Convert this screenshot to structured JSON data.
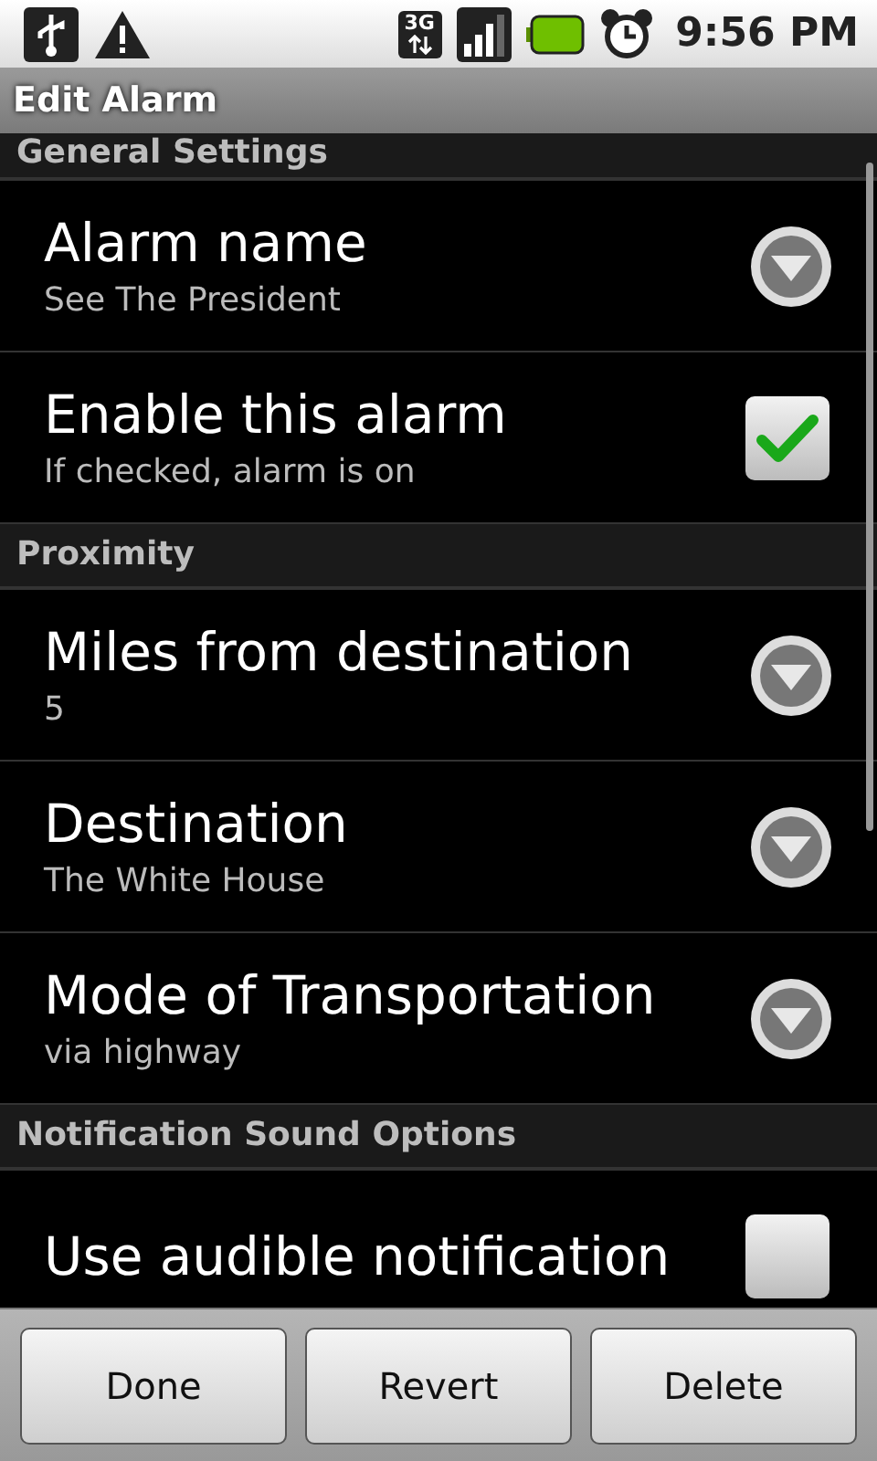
{
  "status_bar": {
    "network": "3G",
    "time": "9:56 PM"
  },
  "title": "Edit Alarm",
  "sections": [
    {
      "header": "General Settings",
      "items": [
        {
          "kind": "dropdown",
          "title": "Alarm name",
          "summary": "See The President"
        },
        {
          "kind": "checkbox",
          "title": "Enable this alarm",
          "summary": "If checked, alarm is on",
          "checked": true
        }
      ]
    },
    {
      "header": "Proximity",
      "items": [
        {
          "kind": "dropdown",
          "title": "Miles from destination",
          "summary": "5"
        },
        {
          "kind": "dropdown",
          "title": "Destination",
          "summary": "The White House"
        },
        {
          "kind": "dropdown",
          "title": "Mode of Transportation",
          "summary": "via highway"
        }
      ]
    },
    {
      "header": "Notification Sound Options",
      "items": [
        {
          "kind": "checkbox",
          "title": "Use audible notification",
          "checked": false
        }
      ]
    }
  ],
  "buttons": [
    "Done",
    "Revert",
    "Delete"
  ]
}
